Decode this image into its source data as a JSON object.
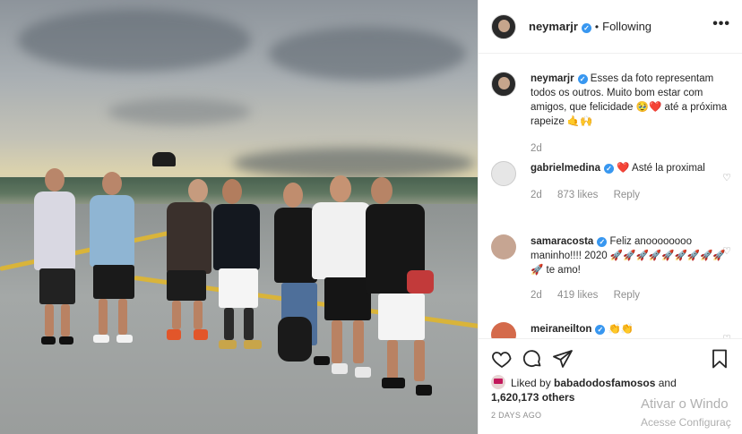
{
  "header": {
    "username": "neymarjr",
    "separator": "•",
    "follow_status": "Following",
    "more": "•••"
  },
  "comments": [
    {
      "username": "neymarjr",
      "text": "Esses da foto representam todos os outros. Muito bom estar com amigos, que felicidade 🥹❤️ até a próxima rapeize 🤙🙌",
      "age": "2d",
      "likes": "",
      "reply": ""
    },
    {
      "username": "gabrielmedina",
      "text": "❤️ Asté la proximal",
      "age": "2d",
      "likes": "873 likes",
      "reply": "Reply"
    },
    {
      "username": "samaracosta",
      "text": "Feliz anoooooooo maninho!!!! 2020 🚀🚀🚀🚀🚀🚀🚀🚀🚀🚀 te amo!",
      "age": "2d",
      "likes": "419 likes",
      "reply": "Reply"
    },
    {
      "username": "meiraneilton",
      "text": "👏👏",
      "age": "",
      "likes": "",
      "reply": ""
    }
  ],
  "likes": {
    "prefix": "Liked by",
    "by_user": "babadodosfamosos",
    "conj": "and",
    "others": "1,620,173 others"
  },
  "date": "2 DAYS AGO",
  "watermark": {
    "line1": "Ativar o Windo",
    "line2": "Acesse Configuraç"
  },
  "colors": {
    "verified": "#3897f0",
    "heart": "#ed4956",
    "muted": "#8e8e8e"
  }
}
